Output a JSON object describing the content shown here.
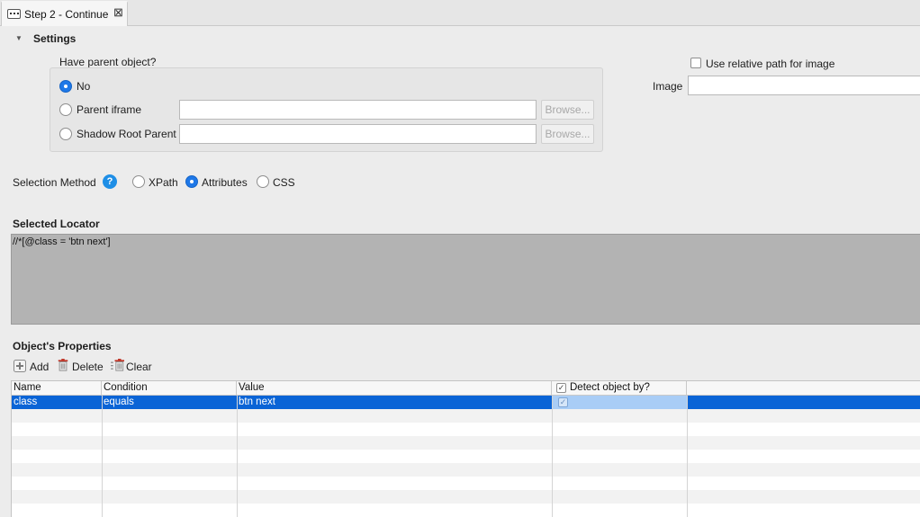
{
  "tab": {
    "title": "Step 2 - Continue"
  },
  "settings": {
    "title": "Settings",
    "parent_object": {
      "label": "Have parent object?",
      "options": [
        {
          "label": "No",
          "selected": true
        },
        {
          "label": "Parent iframe",
          "selected": false,
          "value": "",
          "browse": "Browse..."
        },
        {
          "label": "Shadow Root Parent",
          "selected": false,
          "value": "",
          "browse": "Browse..."
        }
      ]
    },
    "relative_path": {
      "label": "Use relative path for image",
      "checked": false
    },
    "image": {
      "label": "Image",
      "value": ""
    }
  },
  "selection_method": {
    "label": "Selection Method",
    "help_glyph": "?",
    "options": [
      {
        "label": "XPath",
        "selected": false
      },
      {
        "label": "Attributes",
        "selected": true
      },
      {
        "label": "CSS",
        "selected": false
      }
    ]
  },
  "selected_locator": {
    "title": "Selected Locator",
    "value": "//*[@class = 'btn next']"
  },
  "object_properties": {
    "title": "Object's Properties",
    "toolbar": {
      "add": "Add",
      "delete": "Delete",
      "clear": "Clear"
    },
    "columns": [
      "Name",
      "Condition",
      "Value",
      "Detect object by?"
    ],
    "rows": [
      {
        "name": "class",
        "condition": "equals",
        "value": "btn next",
        "detect": true
      }
    ]
  },
  "colors": {
    "accent": "#1e78e8",
    "selection": "#0a64d6",
    "locator_bg": "#b3b3b3"
  }
}
